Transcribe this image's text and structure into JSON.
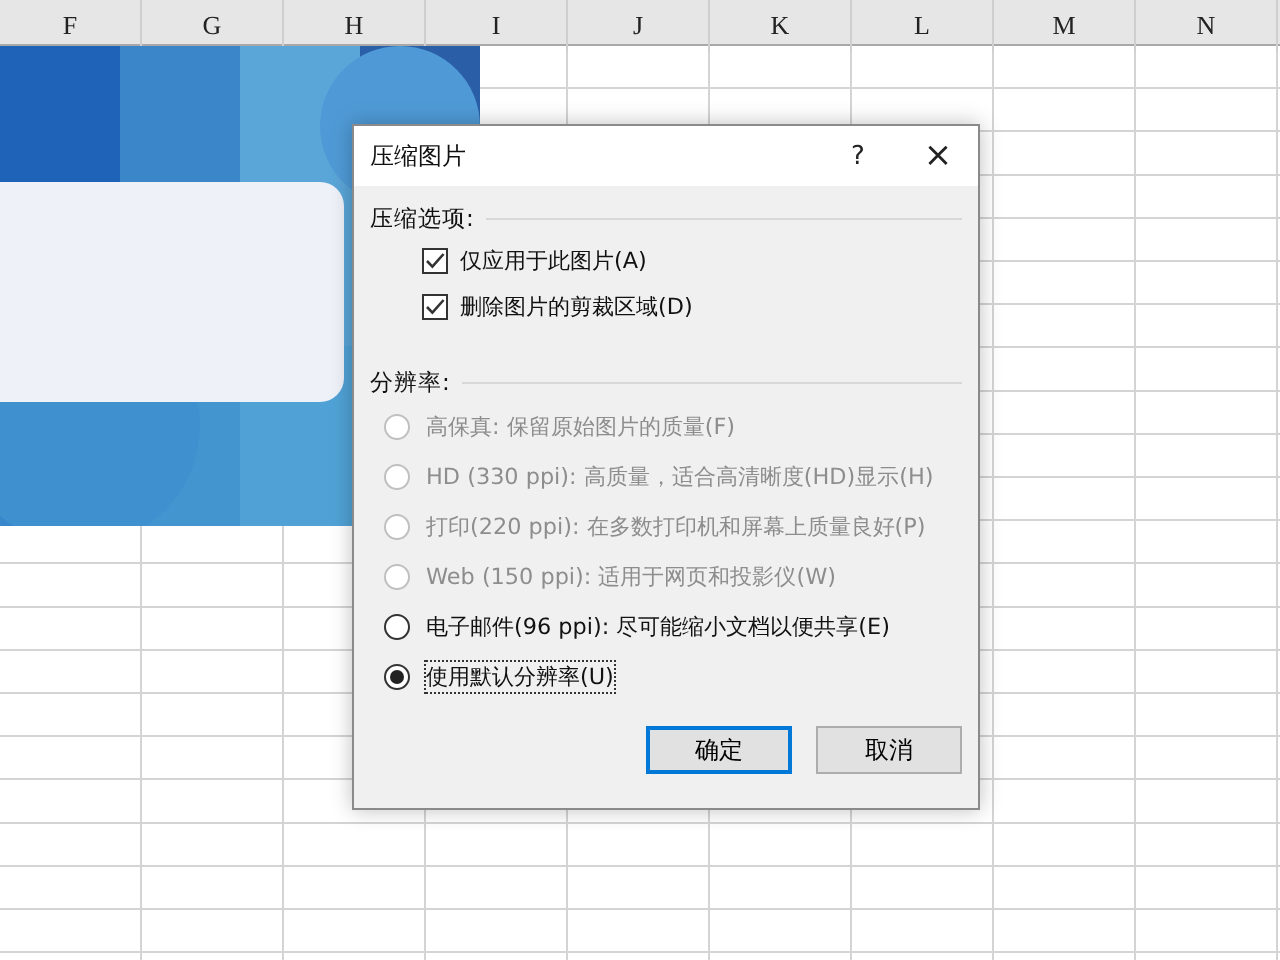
{
  "sheet": {
    "columns": [
      "F",
      "G",
      "H",
      "I",
      "J",
      "K",
      "L",
      "M",
      "N"
    ]
  },
  "dialog": {
    "title": "压缩图片",
    "help": "?",
    "close": "×",
    "compression": {
      "label": "压缩选项:",
      "options": [
        {
          "label": "仅应用于此图片(A)",
          "checked": true
        },
        {
          "label": "删除图片的剪裁区域(D)",
          "checked": true
        }
      ]
    },
    "resolution": {
      "label": "分辨率:",
      "options": [
        {
          "label": "高保真: 保留原始图片的质量(F)",
          "selected": false,
          "disabled": true
        },
        {
          "label": "HD (330 ppi): 高质量，适合高清晰度(HD)显示(H)",
          "selected": false,
          "disabled": true
        },
        {
          "label": "打印(220 ppi): 在多数打印机和屏幕上质量良好(P)",
          "selected": false,
          "disabled": true
        },
        {
          "label": "Web (150 ppi): 适用于网页和投影仪(W)",
          "selected": false,
          "disabled": true
        },
        {
          "label": "电子邮件(96 ppi): 尽可能缩小文档以便共享(E)",
          "selected": false,
          "disabled": false
        },
        {
          "label": "使用默认分辨率(U)",
          "selected": true,
          "disabled": false
        }
      ]
    },
    "buttons": [
      {
        "label": "确定",
        "default": true
      },
      {
        "label": "取消",
        "default": false
      }
    ]
  }
}
